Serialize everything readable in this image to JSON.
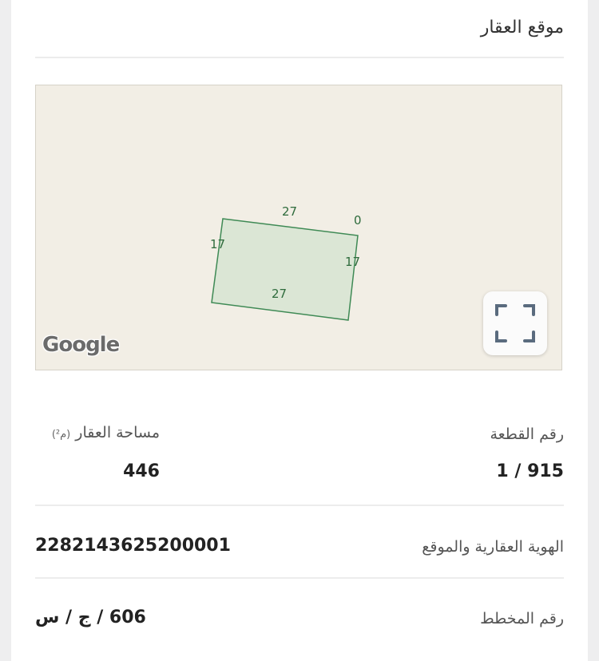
{
  "section": {
    "title": "موقع العقار"
  },
  "map": {
    "dimensions": {
      "top": "27",
      "bottom": "27",
      "left": "17",
      "right": "17",
      "corner": "0"
    },
    "attribution": "Google",
    "expand_icon": "fullscreen-icon"
  },
  "details": {
    "plot_number": {
      "label": "رقم القطعة",
      "value": "1 / 915"
    },
    "area": {
      "label": "مساحة العقار",
      "unit": "(م²)",
      "value": "446"
    },
    "property_id": {
      "label": "الهوية العقارية والموقع",
      "value": "228214362520000​1"
    },
    "plan_number": {
      "label": "رقم المخطط",
      "value": "606 / ج / س"
    }
  },
  "colors": {
    "map_bg": "#f2eee5",
    "parcel_fill": "#d7e4d2",
    "parcel_stroke": "#3f8a55"
  }
}
